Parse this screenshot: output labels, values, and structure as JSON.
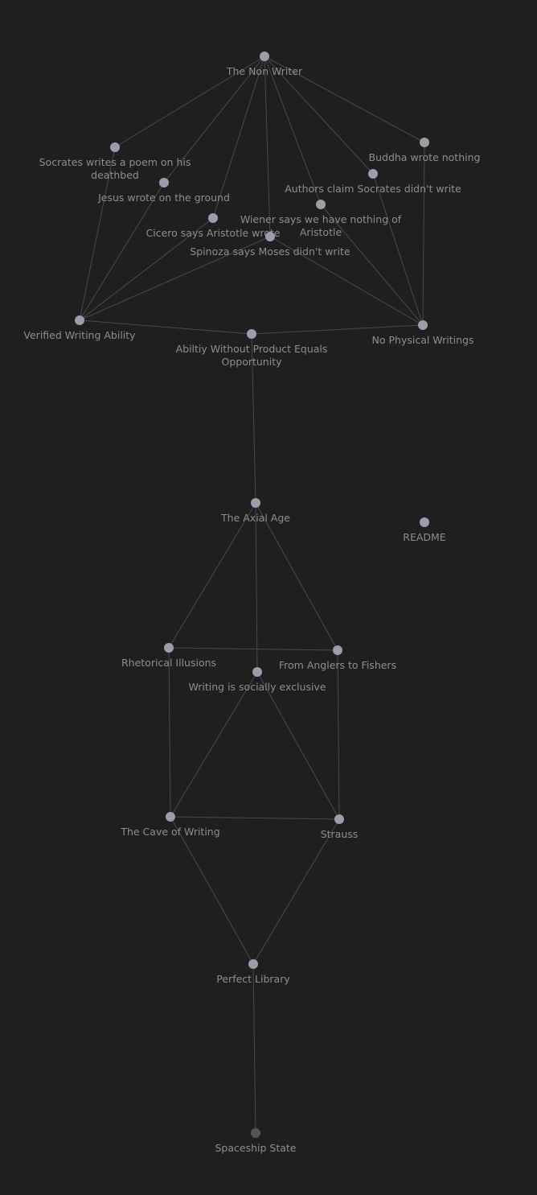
{
  "graph": {
    "colors": {
      "background": "#1f1f1f",
      "edge": "#4a4a4a",
      "node": "#a09aaa",
      "node_dim": "#55535a",
      "label": "#8e8e8e"
    },
    "nodes": [
      {
        "id": "non-writer",
        "label": [
          "The Non Writer"
        ]
      },
      {
        "id": "socrates-poem",
        "label": [
          "Socrates writes a poem on his",
          "deathbed"
        ]
      },
      {
        "id": "buddha",
        "label": [
          "Buddha wrote nothing"
        ]
      },
      {
        "id": "authors-socrates",
        "label": [
          "Authors claim Socrates didn't write"
        ]
      },
      {
        "id": "jesus",
        "label": [
          "Jesus wrote on the ground"
        ]
      },
      {
        "id": "wiener",
        "label": [
          "Wiener says we have nothing of",
          "Aristotle"
        ]
      },
      {
        "id": "cicero",
        "label": [
          "Cicero says Aristotle wrote"
        ]
      },
      {
        "id": "spinoza",
        "label": [
          "Spinoza says Moses didn't write"
        ]
      },
      {
        "id": "verified",
        "label": [
          "Verified Writing Ability"
        ]
      },
      {
        "id": "no-physical",
        "label": [
          "No Physical Writings"
        ]
      },
      {
        "id": "ability",
        "label": [
          "Abiltiy Without Product Equals",
          "Opportunity"
        ]
      },
      {
        "id": "axial",
        "label": [
          "The Axial Age"
        ]
      },
      {
        "id": "readme",
        "label": [
          "README"
        ]
      },
      {
        "id": "rhetorical",
        "label": [
          "Rhetorical Illusions"
        ]
      },
      {
        "id": "anglers",
        "label": [
          "From Anglers to Fishers"
        ]
      },
      {
        "id": "exclusive",
        "label": [
          "Writing is socially exclusive"
        ]
      },
      {
        "id": "cave",
        "label": [
          "The Cave of Writing"
        ]
      },
      {
        "id": "strauss",
        "label": [
          "Strauss"
        ]
      },
      {
        "id": "library",
        "label": [
          "Perfect Library"
        ]
      },
      {
        "id": "spaceship",
        "label": [
          "Spaceship State"
        ],
        "dim": true
      }
    ],
    "edges": [
      [
        "non-writer",
        "socrates-poem"
      ],
      [
        "non-writer",
        "buddha"
      ],
      [
        "non-writer",
        "authors-socrates"
      ],
      [
        "non-writer",
        "jesus"
      ],
      [
        "non-writer",
        "wiener"
      ],
      [
        "non-writer",
        "cicero"
      ],
      [
        "non-writer",
        "spinoza"
      ],
      [
        "socrates-poem",
        "verified"
      ],
      [
        "jesus",
        "verified"
      ],
      [
        "cicero",
        "verified"
      ],
      [
        "spinoza",
        "verified"
      ],
      [
        "buddha",
        "no-physical"
      ],
      [
        "authors-socrates",
        "no-physical"
      ],
      [
        "wiener",
        "no-physical"
      ],
      [
        "spinoza",
        "no-physical"
      ],
      [
        "verified",
        "ability"
      ],
      [
        "no-physical",
        "ability"
      ],
      [
        "ability",
        "axial"
      ],
      [
        "axial",
        "rhetorical"
      ],
      [
        "axial",
        "anglers"
      ],
      [
        "axial",
        "exclusive"
      ],
      [
        "rhetorical",
        "anglers"
      ],
      [
        "rhetorical",
        "cave"
      ],
      [
        "anglers",
        "strauss"
      ],
      [
        "exclusive",
        "cave"
      ],
      [
        "exclusive",
        "strauss"
      ],
      [
        "cave",
        "strauss"
      ],
      [
        "cave",
        "library"
      ],
      [
        "strauss",
        "library"
      ],
      [
        "library",
        "spaceship"
      ]
    ]
  }
}
